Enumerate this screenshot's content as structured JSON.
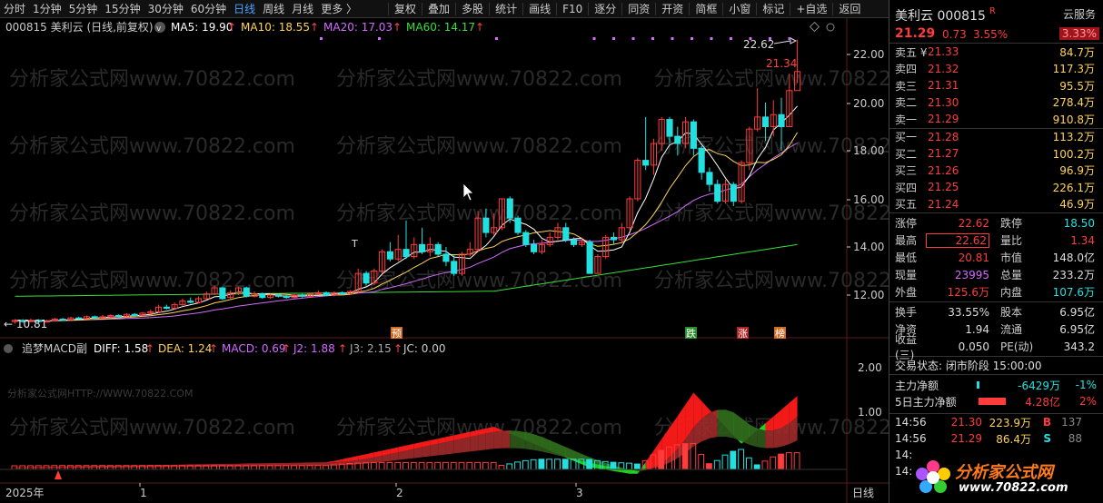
{
  "toolbar": {
    "periods": [
      "分时",
      "1分钟",
      "5分钟",
      "15分钟",
      "30分钟",
      "60分钟",
      "日线",
      "周线",
      "月线",
      "更多 〉"
    ],
    "active_period": "日线",
    "tools": [
      "复权",
      "叠加",
      "多股",
      "统计",
      "画线",
      "F10",
      "逐分",
      "同资",
      "开资",
      "简框",
      "小窗",
      "标记"
    ],
    "add_favorite": "+自选",
    "back": "返回"
  },
  "chart_header": {
    "stock": "000815 美利云 (日线,前复权)",
    "ma5": "MA5: 19.90",
    "ma10": "MA10: 18.55",
    "ma20": "MA20: 17.03",
    "ma60": "MA60: 14.17",
    "colors": {
      "ma5": "#ffffff",
      "ma10": "#ffd35a",
      "ma20": "#d36bff",
      "ma60": "#3cdc3c"
    }
  },
  "price_axis": [
    "22.00",
    "20.00",
    "18.00",
    "16.00",
    "14.00",
    "12.00"
  ],
  "annotations": {
    "max_label": "22.62",
    "last_label": "21.34",
    "min_label": "← 10.81"
  },
  "markers": [
    {
      "text": "预",
      "color": "#d2691e"
    },
    {
      "text": "跌",
      "color": "#2a8f2a"
    },
    {
      "text": "涨",
      "color": "#b22222"
    },
    {
      "text": "榜",
      "color": "#d2691e"
    }
  ],
  "indicator": {
    "name": "追梦MACD副",
    "diff": "DIFF: 1.58",
    "dea": "DEA: 1.24",
    "macd": "MACD: 0.69",
    "j2": "J2: 1.88",
    "j3": "J3: 2.15",
    "jc": "JC: 0.00",
    "axis": [
      "2.00",
      "1.00"
    ]
  },
  "watermark": {
    "main": "分析家公式网www.70822.com",
    "sub": "分析家公式网HTTP://WWW.70822.COM"
  },
  "date_axis": {
    "year": "2025年",
    "months": [
      "1",
      "2",
      "3"
    ],
    "period": "日线"
  },
  "panel": {
    "name": "美利云 000815",
    "r_flag": "R",
    "cloud_button": "云服务",
    "price": "21.29",
    "change": "0.73",
    "change_pct": "3.55%",
    "cloud_pct": "3.33%",
    "asks": [
      {
        "label": "卖五 ¥",
        "price": "21.33",
        "vol": "84.7万"
      },
      {
        "label": "卖四",
        "price": "21.32",
        "vol": "117.3万"
      },
      {
        "label": "卖三",
        "price": "21.31",
        "vol": "95.5万"
      },
      {
        "label": "卖二",
        "price": "21.30",
        "vol": "278.4万"
      },
      {
        "label": "卖一",
        "price": "21.29",
        "vol": "910.8万"
      }
    ],
    "bids": [
      {
        "label": "买一",
        "price": "21.28",
        "vol": "113.2万"
      },
      {
        "label": "买二",
        "price": "21.27",
        "vol": "100.2万"
      },
      {
        "label": "买三",
        "price": "21.26",
        "vol": "96.9万"
      },
      {
        "label": "买四",
        "price": "21.25",
        "vol": "226.1万"
      },
      {
        "label": "买五",
        "price": "21.24",
        "vol": "46.9万"
      }
    ],
    "stats1": [
      {
        "l1": "涨停",
        "v1": "22.62",
        "c1": "red",
        "l2": "跌停",
        "v2": "18.50",
        "c2": "cyan"
      },
      {
        "l1": "最高",
        "v1": "22.62",
        "c1": "red boxed",
        "l2": "量比",
        "v2": "1.34",
        "c2": "red"
      },
      {
        "l1": "最低",
        "v1": "20.81",
        "c1": "red",
        "l2": "市值",
        "v2": "148.0亿",
        "c2": "white"
      },
      {
        "l1": "现量",
        "v1": "23995",
        "c1": "purple",
        "l2": "总量",
        "v2": "233.2万",
        "c2": "white"
      },
      {
        "l1": "外盘",
        "v1": "125.6万",
        "c1": "red",
        "l2": "内盘",
        "v2": "107.6万",
        "c2": "cyan"
      }
    ],
    "stats2": [
      {
        "l1": "换手",
        "v1": "33.55%",
        "c1": "white",
        "l2": "股本",
        "v2": "6.95亿",
        "c2": "white"
      },
      {
        "l1": "净资",
        "v1": "1.94",
        "c1": "white",
        "l2": "流通",
        "v2": "6.95亿",
        "c2": "white"
      },
      {
        "l1": "收益(三)",
        "v1": "0.050",
        "c1": "white",
        "l2": "PE(动)",
        "v2": "343.2",
        "c2": "white"
      }
    ],
    "trade_status": "交易状态: 闭市阶段 15:00:00",
    "flows": [
      {
        "label": "主力净额",
        "value": "-6429万",
        "pct": "-1%",
        "vcolor": "cyan",
        "bar": "cyan"
      },
      {
        "label": "5日主力净额",
        "value": "4.28亿",
        "pct": "2%",
        "vcolor": "red",
        "bar": "red"
      }
    ],
    "ticks": [
      {
        "time": "14:56",
        "price": "21.30",
        "vol": "223.9万",
        "side": "B",
        "sidec": "red",
        "n": "137"
      },
      {
        "time": "14:56",
        "price": "21.29",
        "vol": "86.4万",
        "side": "S",
        "sidec": "cyan",
        "n": "88"
      },
      {
        "time": "14:",
        "price": "",
        "vol": "",
        "side": "",
        "sidec": "red",
        "n": ""
      },
      {
        "time": "14:",
        "price": "",
        "vol": "",
        "side": "",
        "sidec": "red",
        "n": ""
      }
    ],
    "logo_name": "分析家公式网",
    "logo_url": "www.70822.com"
  }
}
